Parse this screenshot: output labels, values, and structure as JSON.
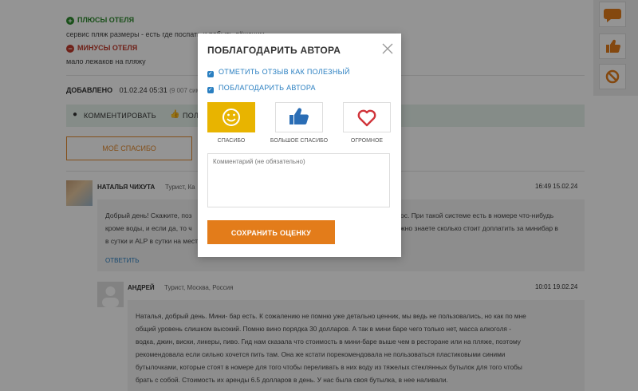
{
  "review": {
    "pros_title": "ПЛЮСЫ ОТЕЛЯ",
    "pros_text": "сервис   пляж   размеры - есть где поспать и побыть лёжачим",
    "cons_title": "МИНУСЫ ОТЕЛЯ",
    "cons_text": "мало лежаков на пляжу",
    "added_label": "ДОБАВЛЕНО",
    "added_date": "01.02.24",
    "added_time": "05:31",
    "views": "(9 007 сим"
  },
  "toolbar": {
    "comment_label": "КОММЕНТИРОВАТЬ",
    "like_label": "ПОЛ"
  },
  "my_thanks_label": "МОЁ СПАСИБО",
  "comments": [
    {
      "author": "НАТАЛЬЯ ЧИХУТА",
      "meta": "Турист, Ка",
      "datetime": "16:49 15.02.24",
      "lines": [
        "Добрый день! Скажите, поз",
        "кроме воды, и если да, то ч",
        "в сутки и ALP в сутки на мест"
      ],
      "lines_right": [
        "ос. При такой системе есть в номере что-нибудь",
        "жно знаете сколько стоит доплатить за минибар в",
        ""
      ],
      "reply_label": "ОТВЕТИТЬ"
    },
    {
      "author": "АНДРЕЙ",
      "meta": "Турист, Москва, Россия",
      "datetime": "10:01 19.02.24",
      "lines": [
        "Наталья, добрый день. Мини- бар есть. К сожалению не помню уже детально ценник, мы ведь не пользовались, но как по мне",
        "общий уровень слишком высокий. Помню вино порядка 30 долларов. А так в мини баре чего только нет, масса алкоголя -",
        "водка, джин, виски, ликеры, пиво. Гид нам сказала что стоимость в мини-баре выше чем в ресторане или на пляже, поэтому",
        "рекомендовала если сильно хочется пить там. Она же кстати порекомендовала не пользоваться пластиковыми синими",
        "бутылочками, которые стоят в номере для того чтобы переливать в них воду из тяжелых стеклянных бутылок для того чтобы",
        "брать с собой. Стоимость их аренды 6.5 долларов в день. У нас была своя бутылка, в нее наливали."
      ]
    }
  ],
  "modal": {
    "title": "ПОБЛАГОДАРИТЬ АВТОРА",
    "check1": "ОТМЕТИТЬ ОТЗЫВ КАК ПОЛЕЗНЫЙ",
    "check2": "ПОБЛАГОДАРИТЬ АВТОРА",
    "options": [
      {
        "label": "СПАСИБО",
        "icon": "smiley-icon",
        "selected": true
      },
      {
        "label": "БОЛЬШОЕ СПАСИБО",
        "icon": "thumbs-up-icon",
        "selected": false
      },
      {
        "label": "ОГРОМНОЕ",
        "icon": "heart-icon",
        "selected": false
      }
    ],
    "comment_placeholder": "Комментарий (не обязательно)",
    "save_label": "СОХРАНИТЬ ОЦЕНКУ"
  },
  "colors": {
    "accent_orange": "#e37c1a",
    "selected_yellow": "#e8b400",
    "link_blue": "#2a7fc1"
  }
}
